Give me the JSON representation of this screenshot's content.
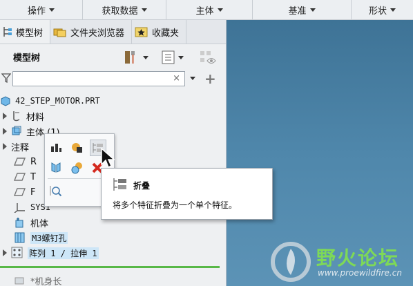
{
  "ribbon_groups": [
    {
      "label": "操作"
    },
    {
      "label": "获取数据"
    },
    {
      "label": "主体"
    },
    {
      "label": "基准"
    },
    {
      "label": "形状"
    }
  ],
  "tabs": [
    {
      "label": "模型树"
    },
    {
      "label": "文件夹浏览器"
    },
    {
      "label": "收藏夹"
    }
  ],
  "tree_title": "模型树",
  "search": {
    "value": "",
    "placeholder": "",
    "clear_glyph": "×"
  },
  "tree": [
    {
      "label": "42_STEP_MOTOR.PRT",
      "icon": "part-icon"
    },
    {
      "label": "材料",
      "icon": "material-icon"
    },
    {
      "label": "主体 (1)",
      "icon": "body-icon"
    },
    {
      "label": "注释",
      "icon": "annotation-icon"
    },
    {
      "label": "R",
      "icon": "datum-plane-icon"
    },
    {
      "label": "T",
      "icon": "datum-plane-icon"
    },
    {
      "label": "F",
      "icon": "datum-plane-icon"
    },
    {
      "label": "SYS1",
      "icon": "csys-icon"
    },
    {
      "label": "机体",
      "icon": "feature-icon"
    },
    {
      "label": "M3螺钉孔",
      "icon": "hole-icon"
    },
    {
      "label": "阵列 1 / 拉伸 1",
      "icon": "pattern-icon"
    },
    {
      "label": "*机身长",
      "icon": "extrude-icon"
    }
  ],
  "tooltip": {
    "title": "折叠",
    "description": "将多个特征折叠为一个单个特征。"
  },
  "watermark": {
    "text": "野火论坛",
    "url": "www.proewildfire.cn"
  },
  "colors": {
    "graphics_top": "#3e7396",
    "graphics_bottom": "#5c93b6",
    "selection": "#cde6f7",
    "accent_green": "#58b848",
    "delete_red": "#d42a1f"
  }
}
